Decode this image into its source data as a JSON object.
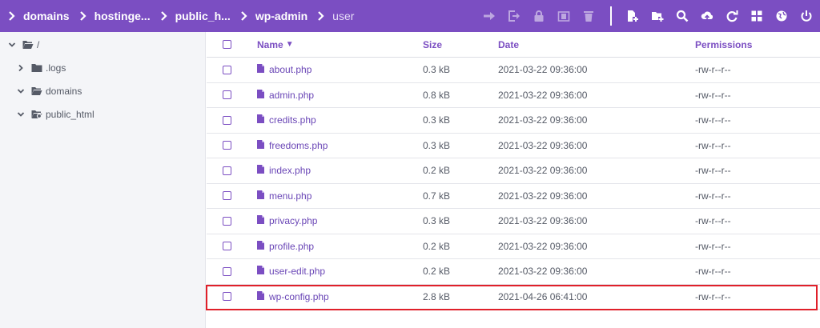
{
  "breadcrumbs": [
    "domains",
    "hostinge...",
    "public_h...",
    "wp-admin",
    "user"
  ],
  "toolbar": {
    "icons": [
      "move-icon",
      "exit-icon",
      "lock-icon",
      "archive-icon",
      "trash-icon",
      "new-file-icon",
      "new-folder-icon",
      "search-icon",
      "upload-icon",
      "refresh-icon",
      "grid-view-icon",
      "globe-icon",
      "power-icon"
    ]
  },
  "sidebar": {
    "items": [
      {
        "label": "/",
        "expanded": true,
        "icon": "folder-open-icon"
      },
      {
        "label": ".logs",
        "expanded": false,
        "icon": "folder-icon"
      },
      {
        "label": "domains",
        "expanded": true,
        "icon": "folder-open-icon"
      },
      {
        "label": "public_html",
        "expanded": true,
        "icon": "folder-link-icon"
      }
    ]
  },
  "table": {
    "headers": {
      "name": "Name",
      "sort": "▼",
      "size": "Size",
      "date": "Date",
      "permissions": "Permissions"
    },
    "rows": [
      {
        "name": "about.php",
        "size": "0.3 kB",
        "date": "2021-03-22 09:36:00",
        "perm": "-rw-r--r--"
      },
      {
        "name": "admin.php",
        "size": "0.8 kB",
        "date": "2021-03-22 09:36:00",
        "perm": "-rw-r--r--"
      },
      {
        "name": "credits.php",
        "size": "0.3 kB",
        "date": "2021-03-22 09:36:00",
        "perm": "-rw-r--r--"
      },
      {
        "name": "freedoms.php",
        "size": "0.3 kB",
        "date": "2021-03-22 09:36:00",
        "perm": "-rw-r--r--"
      },
      {
        "name": "index.php",
        "size": "0.2 kB",
        "date": "2021-03-22 09:36:00",
        "perm": "-rw-r--r--"
      },
      {
        "name": "menu.php",
        "size": "0.7 kB",
        "date": "2021-03-22 09:36:00",
        "perm": "-rw-r--r--"
      },
      {
        "name": "privacy.php",
        "size": "0.3 kB",
        "date": "2021-03-22 09:36:00",
        "perm": "-rw-r--r--"
      },
      {
        "name": "profile.php",
        "size": "0.2 kB",
        "date": "2021-03-22 09:36:00",
        "perm": "-rw-r--r--"
      },
      {
        "name": "user-edit.php",
        "size": "0.2 kB",
        "date": "2021-03-22 09:36:00",
        "perm": "-rw-r--r--"
      },
      {
        "name": "wp-config.php",
        "size": "2.8 kB",
        "date": "2021-04-26 06:41:00",
        "perm": "-rw-r--r--"
      }
    ]
  },
  "colors": {
    "accent": "#7b4ec2",
    "highlight_border": "#e0202a"
  }
}
